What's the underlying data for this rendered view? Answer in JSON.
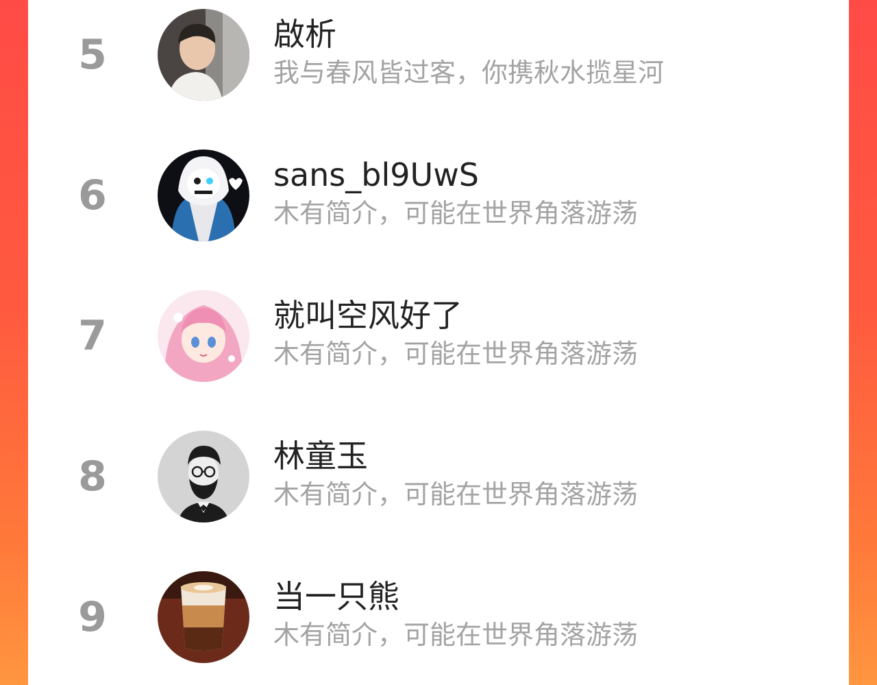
{
  "users": [
    {
      "rank": "5",
      "name": "啟析",
      "bio": "我与春风皆过客，你携秋水揽星河",
      "avatar": "portrait-photo-icon"
    },
    {
      "rank": "6",
      "name": "sans_bl9UwS",
      "bio": "木有简介，可能在世界角落游荡",
      "avatar": "hooded-skull-icon"
    },
    {
      "rank": "7",
      "name": "就叫空风好了",
      "bio": "木有简介，可能在世界角落游荡",
      "avatar": "anime-girl-icon"
    },
    {
      "rank": "8",
      "name": "林童玉",
      "bio": "木有简介，可能在世界角落游荡",
      "avatar": "bearded-man-icon"
    },
    {
      "rank": "9",
      "name": "当一只熊",
      "bio": "木有简介，可能在世界角落游荡",
      "avatar": "coffee-glass-icon"
    }
  ],
  "colors": {
    "background_gradient_top": "#ff4b46",
    "background_gradient_bottom": "#ff9640",
    "card": "#ffffff",
    "rank_text": "#9a9a9a",
    "name_text": "#222222",
    "bio_text": "#a3a3a3"
  }
}
